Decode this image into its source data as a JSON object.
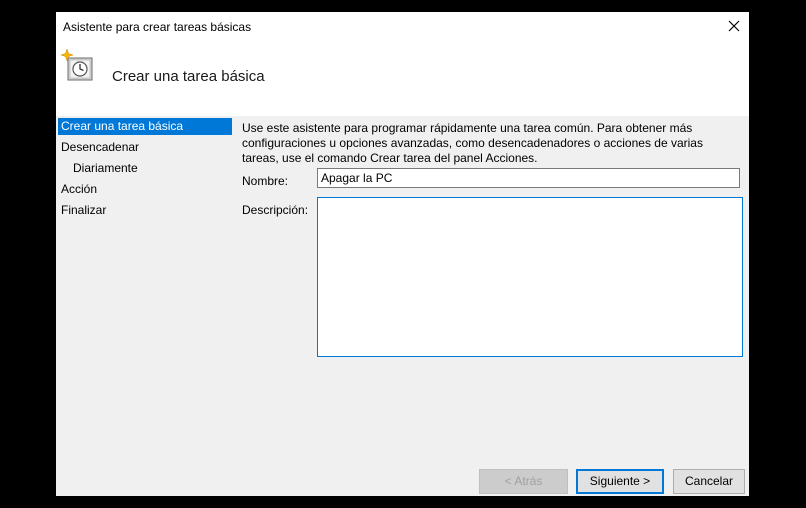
{
  "window": {
    "title": "Asistente para crear tareas básicas"
  },
  "header": {
    "title": "Crear una tarea básica",
    "icon": "clock-task-icon"
  },
  "nav": {
    "items": [
      {
        "label": "Crear una tarea básica",
        "active": true
      },
      {
        "label": "Desencadenar"
      },
      {
        "label": "Diariamente"
      },
      {
        "label": "Acción"
      },
      {
        "label": "Finalizar"
      }
    ]
  },
  "content": {
    "description": "Use este asistente para programar rápidamente una tarea común. Para obtener más configuraciones u opciones avanzadas, como desencadenadores o acciones de varias tareas, use el comando Crear tarea del panel Acciones.",
    "name_label": "Nombre:",
    "name_value": "Apagar la PC",
    "description_label": "Descripción:",
    "description_value": ""
  },
  "buttons": {
    "back": "< Atrás",
    "next": "Siguiente >",
    "cancel": "Cancelar"
  },
  "colors": {
    "accent": "#0078d7",
    "window_bg": "#f0f0f0"
  }
}
